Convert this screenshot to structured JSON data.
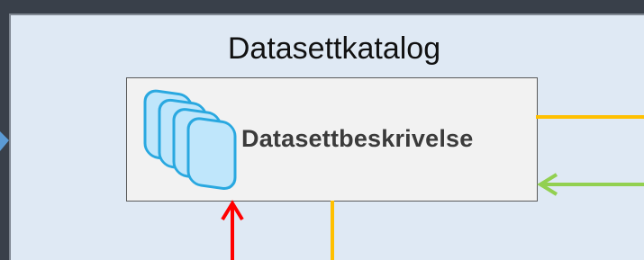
{
  "catalog": {
    "title": "Datasettkatalog",
    "card_label": "Datasettbeskrivelse"
  },
  "colors": {
    "background": "#39404a",
    "panel": "#dfe9f4",
    "card": "#f2f2f2",
    "yellow_line": "#ffc000",
    "green_arrow": "#92d050",
    "red_arrow": "#ff0000",
    "icon_fill": "#bfe6fb",
    "icon_stroke": "#29a8e0",
    "side_marker": "#5b9bd5"
  },
  "icons": [
    "stacked-datasets-icon"
  ]
}
